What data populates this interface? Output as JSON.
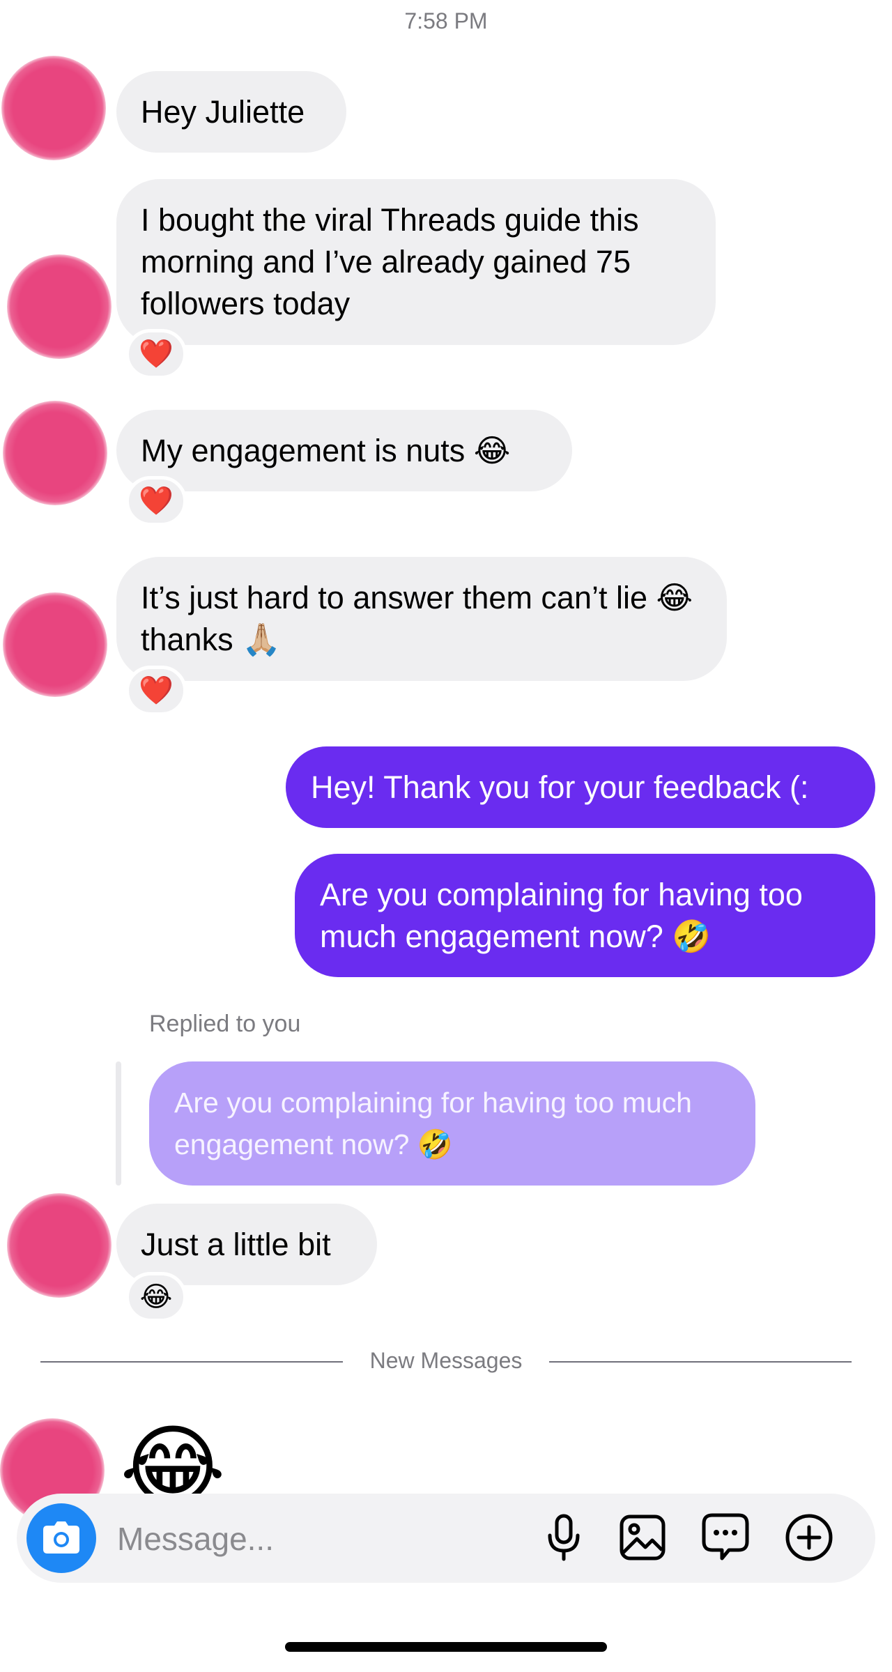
{
  "status": {
    "time": "7:58 PM"
  },
  "messages": [
    {
      "text": "Hey Juliette"
    },
    {
      "text": "I bought the viral Threads guide this morning and I’ve already gained 75 followers today",
      "reaction": "❤️"
    },
    {
      "text": "My engagement is nuts 😂",
      "reaction": "❤️"
    },
    {
      "text": "It’s just hard to answer them can’t lie 😂 thanks 🙏🏼",
      "reaction": "❤️"
    },
    {
      "text": "Hey! Thank you for your feedback (:"
    },
    {
      "text": "Are you complaining for having too much engagement now? 🤣"
    },
    {
      "text": "Just a little bit",
      "reaction": "😂"
    },
    {
      "text": "😂"
    }
  ],
  "reply": {
    "label": "Replied to you",
    "quoted_text": "Are you complaining for having too much engagement now? 🤣"
  },
  "divider": {
    "label": "New Messages"
  },
  "composer": {
    "placeholder": "Message...",
    "icons": [
      "camera-icon",
      "microphone-icon",
      "gallery-icon",
      "sticker-chat-icon",
      "add-icon"
    ]
  },
  "colors": {
    "outgoing_bubble": "#6a2cf0",
    "incoming_bubble": "#efeff1",
    "quoted_bubble": "#b7a0f9",
    "avatar": "#e8457f",
    "camera_button": "#1e88f5"
  }
}
